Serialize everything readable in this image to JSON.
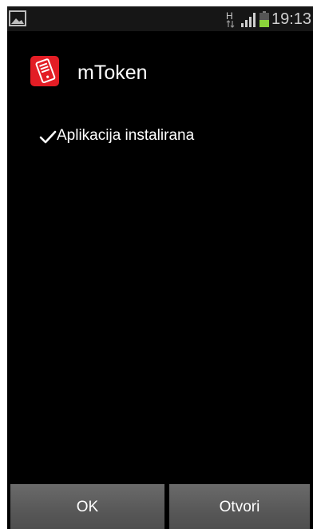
{
  "status_bar": {
    "time": "19:13",
    "network_type": "H",
    "icons": [
      "gallery-icon",
      "network-h-icon",
      "signal-icon",
      "battery-icon"
    ]
  },
  "app": {
    "name": "mToken",
    "icon": "mtoken-app-icon",
    "accent_color": "#e31d25"
  },
  "message": {
    "icon": "check-icon",
    "text": "Aplikacija instalirana"
  },
  "buttons": {
    "ok_label": "OK",
    "open_label": "Otvori"
  }
}
